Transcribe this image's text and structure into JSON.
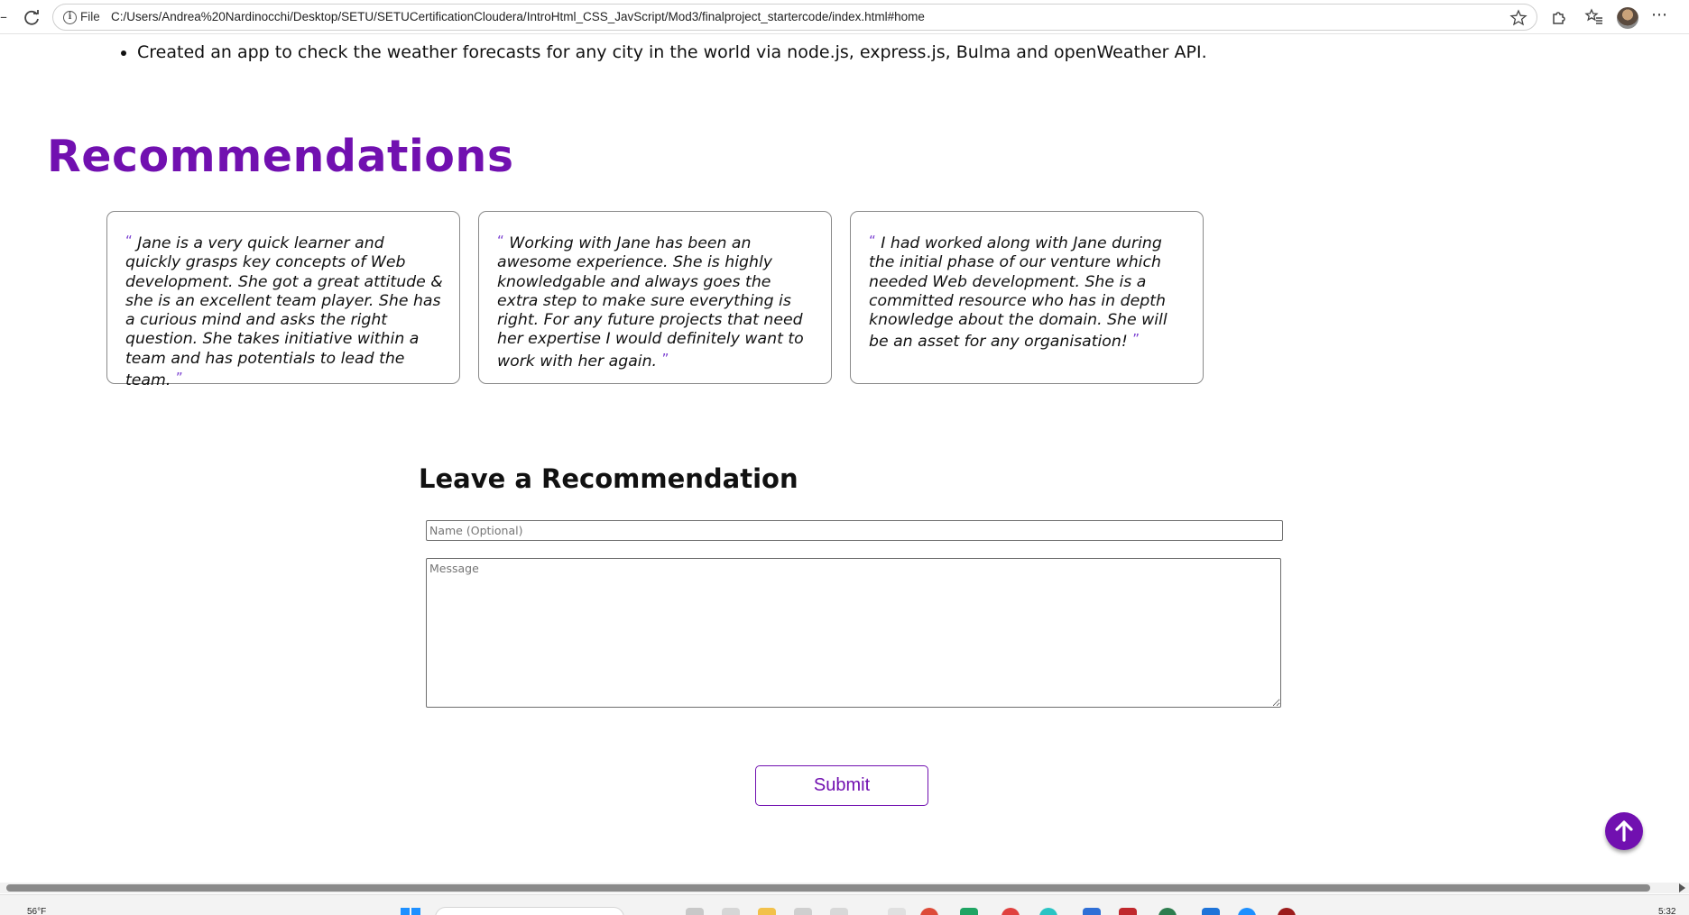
{
  "browser": {
    "protocol_label": "File",
    "url": "C:/Users/Andrea%20Nardinocchi/Desktop/SETU/SETUCertificationCloudera/IntroHtml_CSS_JavScript/Mod3/finalproject_startercode/index.html#home",
    "nav_left_glyph": "–"
  },
  "projects": {
    "items": [
      "Created an app to check the weather forecasts for any city in the world via node.js, express.js, Bulma and openWeather API."
    ]
  },
  "recommendations": {
    "heading": "Recommendations",
    "open_quote": "“",
    "close_quote": "”",
    "cards": [
      {
        "text": "Jane is a very quick learner and quickly grasps key concepts of Web development. She got a great attitude & she is an excellent team player. She has a curious mind and asks the right question. She takes initiative within a team and has potentials to lead the team."
      },
      {
        "text": "Working with Jane has been an awesome experience. She is highly knowledgable and always goes the extra step to make sure everything is right. For any future projects that need her expertise I would definitely want to work with her again."
      },
      {
        "text": "I had worked along with Jane during the initial phase of our venture which needed Web development. She is a committed resource who has in depth knowledge about the domain. She will be an asset for any organisation!"
      }
    ]
  },
  "form": {
    "heading": "Leave a Recommendation",
    "name_placeholder": "Name (Optional)",
    "name_value": "",
    "message_placeholder": "Message",
    "message_value": "",
    "submit_label": "Submit"
  },
  "taskbar": {
    "weather": "56°F",
    "clock": "5:32 PM"
  },
  "colors": {
    "accent": "#7110b0"
  }
}
